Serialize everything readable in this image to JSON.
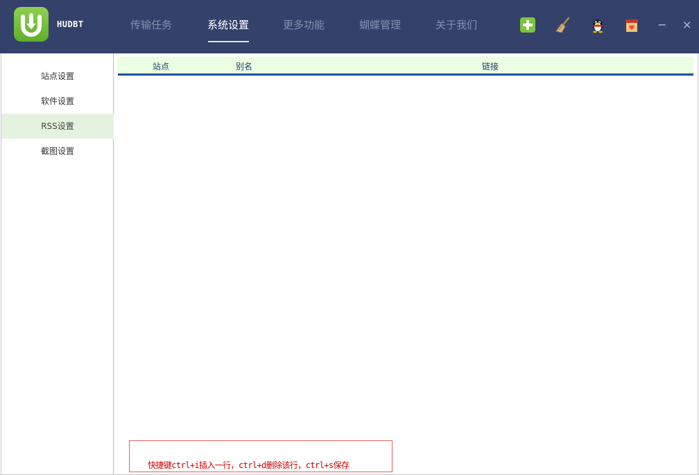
{
  "app": {
    "name": "HUDBT"
  },
  "nav": {
    "tabs": [
      {
        "label": "传输任务"
      },
      {
        "label": "系统设置"
      },
      {
        "label": "更多功能"
      },
      {
        "label": "蝴蝶管理"
      },
      {
        "label": "关于我们"
      }
    ],
    "active_tab": "系统设置"
  },
  "toolbar": {
    "icons": [
      "add-icon",
      "broom-icon",
      "qq-penguin-icon",
      "gift-box-icon"
    ],
    "minimize": "−",
    "close": "×"
  },
  "sidebar": {
    "items": [
      {
        "label": "站点设置"
      },
      {
        "label": "软件设置"
      },
      {
        "label": "RSS设置"
      },
      {
        "label": "截图设置"
      }
    ],
    "active_item": "RSS设置"
  },
  "table": {
    "columns": [
      "站点",
      "别名",
      "链接"
    ],
    "rows": []
  },
  "hint": {
    "text": "快捷键ctrl+i插入一行，ctrl+d删除该行，ctrl+s保存"
  },
  "colors": {
    "titlebar": "#34416a",
    "active_sidebar": "#e4f2df",
    "table_header": "#eaffe1",
    "table_header_border": "#1a4f9e",
    "hint_text": "#d40000"
  }
}
